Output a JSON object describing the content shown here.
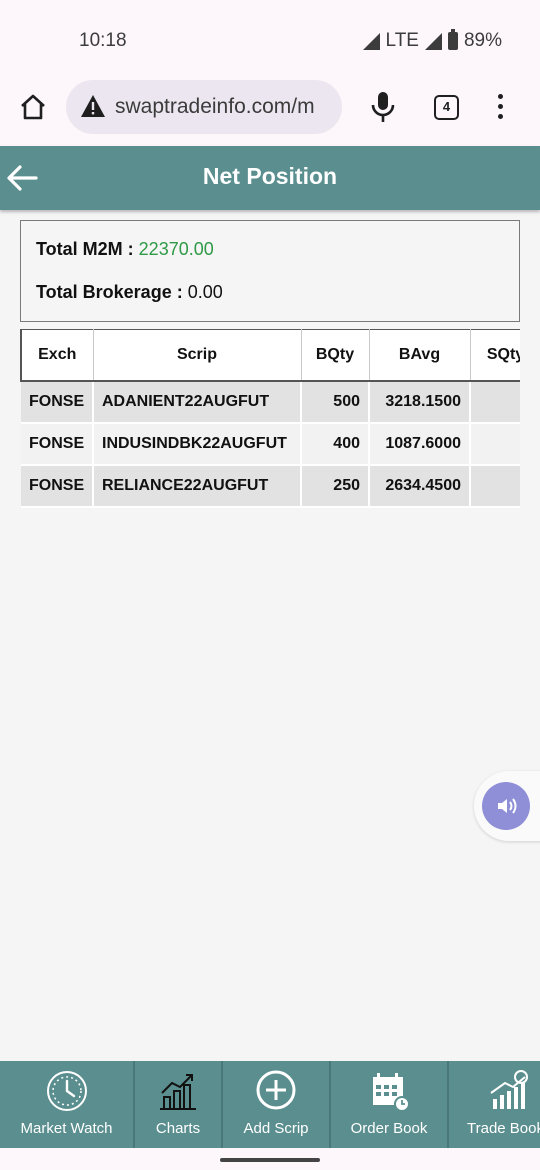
{
  "status_bar": {
    "time": "10:18",
    "network": "LTE",
    "battery": "89%"
  },
  "browser": {
    "url": "swaptradeinfo.com/m",
    "tab_count": "4"
  },
  "header": {
    "title": "Net Position"
  },
  "summary": {
    "m2m_label": "Total M2M :",
    "m2m_value": "22370.00",
    "brokerage_label": "Total Brokerage :",
    "brokerage_value": "0.00"
  },
  "table": {
    "headers": [
      "Exch",
      "Scrip",
      "BQty",
      "BAvg",
      "SQty"
    ],
    "rows": [
      {
        "exch": "FONSE",
        "scrip": "ADANIENT22AUGFUT",
        "bqty": "500",
        "bavg": "3218.1500",
        "sqty": ""
      },
      {
        "exch": "FONSE",
        "scrip": "INDUSINDBK22AUGFUT",
        "bqty": "400",
        "bavg": "1087.6000",
        "sqty": ""
      },
      {
        "exch": "FONSE",
        "scrip": "RELIANCE22AUGFUT",
        "bqty": "250",
        "bavg": "2634.4500",
        "sqty": ""
      }
    ]
  },
  "bottom_nav": {
    "items": [
      {
        "label": "Market Watch",
        "icon": "clock-icon"
      },
      {
        "label": "Charts",
        "icon": "chart-icon"
      },
      {
        "label": "Add Scrip",
        "icon": "plus-circle-icon"
      },
      {
        "label": "Order Book",
        "icon": "calendar-icon"
      },
      {
        "label": "Trade Book",
        "icon": "trade-icon"
      }
    ]
  },
  "colors": {
    "header": "#5b8f8f",
    "m2m_value": "#2e9a46",
    "float_button": "#8e8fd6"
  }
}
